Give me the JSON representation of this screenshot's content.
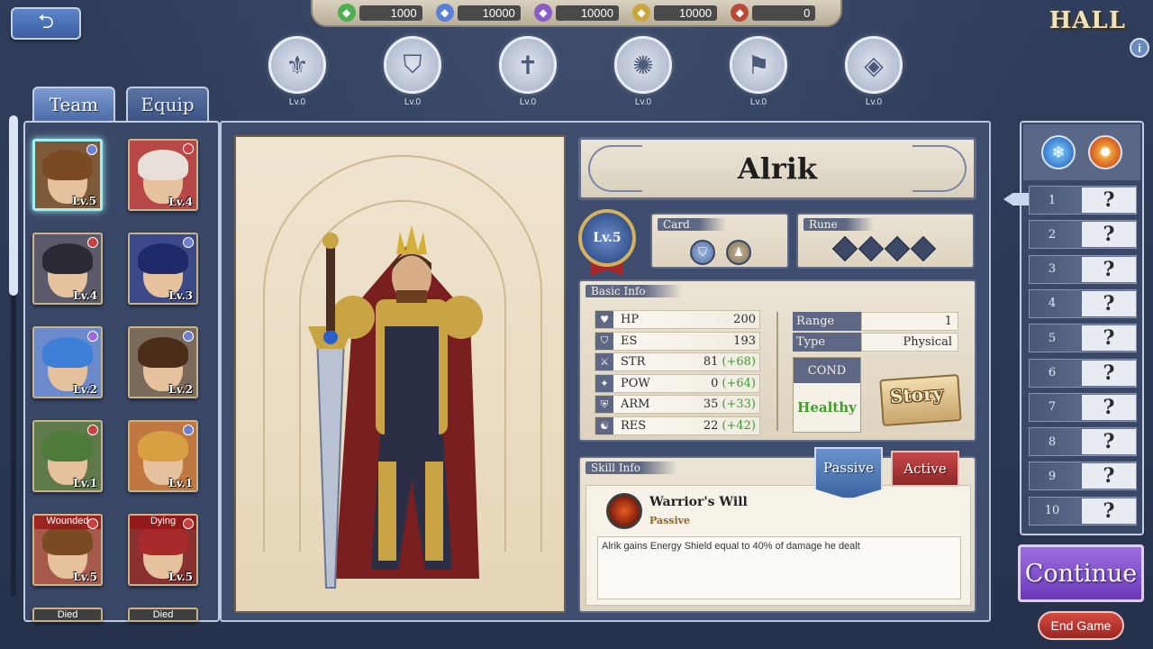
{
  "currencies": [
    {
      "icon": "green-gem-icon",
      "value": "1000",
      "color": "#4caf50"
    },
    {
      "icon": "blue-cog-icon",
      "value": "10000",
      "color": "#5b7fd6"
    },
    {
      "icon": "purple-crystal-icon",
      "value": "10000",
      "color": "#8a5cc7"
    },
    {
      "icon": "gold-shard-icon",
      "value": "10000",
      "color": "#c9a53a"
    },
    {
      "icon": "red-feather-icon",
      "value": "0",
      "color": "#b84a3a"
    }
  ],
  "header": {
    "title": "HALL",
    "info": "i",
    "back": "⮌"
  },
  "emblems": [
    {
      "icon": "sword-crest-icon",
      "glyph": "⚜",
      "lv": "Lv.0"
    },
    {
      "icon": "shield-crest-icon",
      "glyph": "⛉",
      "lv": "Lv.0"
    },
    {
      "icon": "cross-crest-icon",
      "glyph": "✝",
      "lv": "Lv.0"
    },
    {
      "icon": "flame-crest-icon",
      "glyph": "✺",
      "lv": "Lv.0"
    },
    {
      "icon": "banner-crest-icon",
      "glyph": "⚑",
      "lv": "Lv.0"
    },
    {
      "icon": "diamond-crest-icon",
      "glyph": "◈",
      "lv": "Lv.0"
    }
  ],
  "tabs": {
    "team": "Team",
    "equip": "Equip"
  },
  "heroes": [
    {
      "lv": "Lv.5",
      "hair": "#7a4a22",
      "bg": "#7d5a3a",
      "elem": "#6e7fcf",
      "selected": true,
      "status": ""
    },
    {
      "lv": "Lv.4",
      "hair": "#e8e0d8",
      "bg": "#b84848",
      "elem": "#c84040",
      "selected": false,
      "status": ""
    },
    {
      "lv": "Lv.4",
      "hair": "#2a2a34",
      "bg": "#5a5a6a",
      "elem": "#c84040",
      "selected": false,
      "status": ""
    },
    {
      "lv": "Lv.3",
      "hair": "#1e2a6a",
      "bg": "#3c4a8a",
      "elem": "#6e7fcf",
      "selected": false,
      "status": ""
    },
    {
      "lv": "Lv.2",
      "hair": "#3e7fd8",
      "bg": "#6a8acb",
      "elem": "#9a6ad6",
      "selected": false,
      "status": ""
    },
    {
      "lv": "Lv.2",
      "hair": "#4a2e1a",
      "bg": "#7a6a5a",
      "elem": "#6e7fcf",
      "selected": false,
      "status": ""
    },
    {
      "lv": "Lv.1",
      "hair": "#4e7a3a",
      "bg": "#5e7a4a",
      "elem": "#c84040",
      "selected": false,
      "status": ""
    },
    {
      "lv": "Lv.1",
      "hair": "#d8a040",
      "bg": "#c07840",
      "elem": "#6e7fcf",
      "selected": false,
      "status": ""
    },
    {
      "lv": "Lv.5",
      "hair": "#7a4a22",
      "bg": "#a85a4a",
      "elem": "#c84040",
      "selected": false,
      "status": "Wounded"
    },
    {
      "lv": "Lv.5",
      "hair": "#a82a2a",
      "bg": "#8a3030",
      "elem": "#c84040",
      "selected": false,
      "status": "Dying"
    }
  ],
  "heroes_partial": [
    {
      "status": "Died"
    },
    {
      "status": "Died"
    }
  ],
  "character": {
    "name": "Alrik",
    "level": "Lv.5",
    "card_label": "Card",
    "rune_label": "Rune",
    "basic_info_label": "Basic Info",
    "stats": [
      {
        "icon": "heart-icon",
        "glyph": "♥",
        "label": "HP",
        "value": "200",
        "bonus": ""
      },
      {
        "icon": "shield-icon",
        "glyph": "⛉",
        "label": "ES",
        "value": "193",
        "bonus": ""
      },
      {
        "icon": "sword-icon",
        "glyph": "⚔",
        "label": "STR",
        "value": "81",
        "bonus": "(+68)"
      },
      {
        "icon": "wand-icon",
        "glyph": "✦",
        "label": "POW",
        "value": "0",
        "bonus": "(+64)"
      },
      {
        "icon": "armor-icon",
        "glyph": "⛨",
        "label": "ARM",
        "value": "35",
        "bonus": "(+33)"
      },
      {
        "icon": "resist-icon",
        "glyph": "☯",
        "label": "RES",
        "value": "22",
        "bonus": "(+42)"
      }
    ],
    "range_label": "Range",
    "range_value": "1",
    "type_label": "Type",
    "type_value": "Physical",
    "cond_label": "COND",
    "cond_value": "Healthy",
    "story_label": "Story"
  },
  "skill": {
    "info_label": "Skill Info",
    "passive_tab": "Passive",
    "active_tab": "Active",
    "name": "Warrior's Will",
    "type": "Passive",
    "description": "Alrik gains Energy Shield equal to 40% of damage he dealt"
  },
  "slots": [
    "1",
    "2",
    "3",
    "4",
    "5",
    "6",
    "7",
    "8",
    "9",
    "10"
  ],
  "slot_unknown": "?",
  "buttons": {
    "continue": "Continue",
    "end_game": "End Game"
  }
}
